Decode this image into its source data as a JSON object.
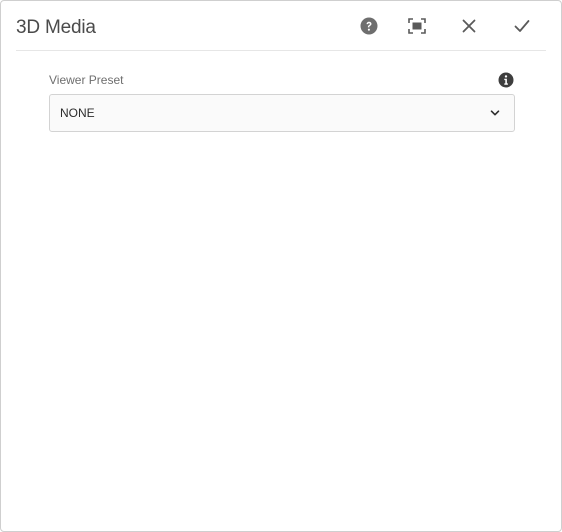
{
  "dialog": {
    "title": "3D Media",
    "actions": [
      {
        "name": "help",
        "icon": "help-icon"
      },
      {
        "name": "fullscreen",
        "icon": "fullscreen-icon"
      },
      {
        "name": "close",
        "icon": "close-icon"
      },
      {
        "name": "done",
        "icon": "checkmark-icon"
      }
    ]
  },
  "form": {
    "viewer_preset": {
      "label": "Viewer Preset",
      "value": "NONE",
      "info_icon": "info-icon"
    }
  },
  "colors": {
    "text": "#4b4b4b",
    "icon": "#6e6e6e",
    "border": "#d3d3d3",
    "field_bg": "#fafafa"
  }
}
